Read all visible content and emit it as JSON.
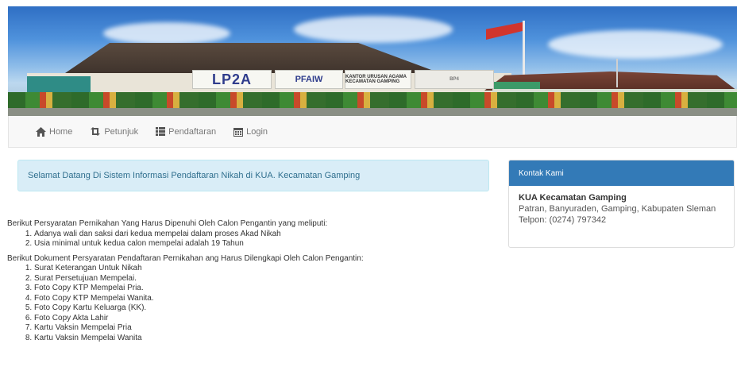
{
  "banner": {
    "signs": [
      "LP2A",
      "PFAIW",
      "KANTOR URUSAN AGAMA KECAMATAN GAMPING",
      "BP4"
    ]
  },
  "navbar": {
    "items": [
      {
        "label": "Home",
        "icon": "home-icon"
      },
      {
        "label": "Petunjuk",
        "icon": "retweet-icon"
      },
      {
        "label": "Pendaftaran",
        "icon": "list-icon"
      },
      {
        "label": "Login",
        "icon": "calendar-icon"
      }
    ]
  },
  "alert": {
    "text": "Selamat Datang Di Sistem Informasi Pendaftaran Nikah di KUA. Kecamatan Gamping"
  },
  "panel": {
    "title": "Kontak Kami",
    "name": "KUA Kecamatan Gamping",
    "address": "Patran, Banyuraden, Gamping, Kabupaten Sleman",
    "phone": "Telpon: (0274) 797342"
  },
  "content": {
    "requirements_intro": "Berikut Persyaratan Pernikahan Yang Harus Dipenuhi Oleh Calon Pengantin yang meliputi:",
    "requirements": [
      "Adanya wali dan saksi dari kedua mempelai dalam proses Akad Nikah",
      "Usia minimal untuk kedua calon mempelai adalah 19 Tahun"
    ],
    "documents_intro": "Berikut Dokument Persyaratan Pendaftaran Pernikahan ang Harus Dilengkapi Oleh Calon Pengantin:",
    "documents": [
      "Surat Keterangan Untuk Nikah",
      "Surat Persetujuan Mempelai.",
      "Foto Copy KTP Mempelai Pria.",
      "Foto Copy KTP Mempelai Wanita.",
      "Foto Copy Kartu Keluarga (KK).",
      "Foto Copy Akta Lahir",
      "Kartu Vaksin Mempelai Pria",
      "Kartu Vaksin Mempelai Wanita"
    ]
  },
  "colors": {
    "navbar_bg": "#f8f8f8",
    "alert_bg": "#d9edf7",
    "alert_text": "#31708f",
    "panel_head": "#337ab7"
  }
}
